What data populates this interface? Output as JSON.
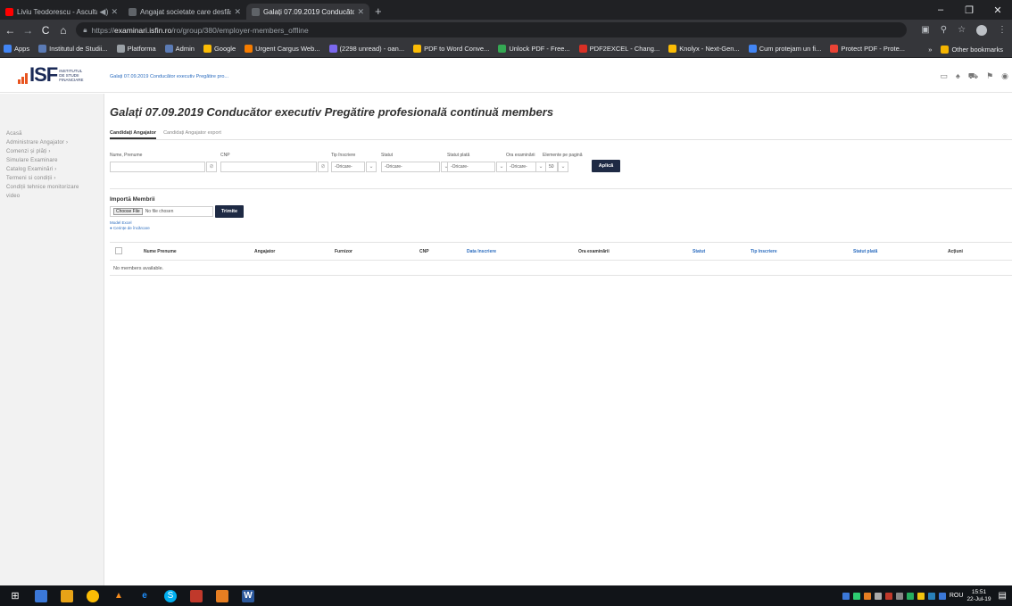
{
  "browser": {
    "tabs": [
      {
        "title": "Liviu Teodorescu - Asculta |",
        "color": "#ff0000",
        "active": false
      },
      {
        "title": "Angajat societate care desfășoar",
        "color": "#5f6368",
        "active": false
      },
      {
        "title": "Galați 07.09.2019 Conducător ex",
        "color": "#5f6368",
        "active": true
      }
    ],
    "new_tab": "+",
    "url_scheme": "https://",
    "url_host": "examinari.isfin.ro",
    "url_path": "/ro/group/380/employer-members_offline",
    "bookmarks": [
      {
        "label": "Apps",
        "color": "#4285f4"
      },
      {
        "label": "Institutul de Studii...",
        "color": "#5b7bb5"
      },
      {
        "label": "Platforma",
        "color": "#9aa0a6"
      },
      {
        "label": "Admin",
        "color": "#5b7bb5"
      },
      {
        "label": "Google",
        "color": "#fbbc05"
      },
      {
        "label": "Urgent Cargus Web...",
        "color": "#f57c00"
      },
      {
        "label": "(2298 unread) - oan...",
        "color": "#7b68ee"
      },
      {
        "label": "PDF to Word Conve...",
        "color": "#fbbc05"
      },
      {
        "label": "Unlock PDF - Free...",
        "color": "#34a853"
      },
      {
        "label": "PDF2EXCEL - Chang...",
        "color": "#d93025"
      },
      {
        "label": "Knolyx - Next-Gen...",
        "color": "#fbbc05"
      },
      {
        "label": "Cum protejam un fi...",
        "color": "#4285f4"
      },
      {
        "label": "Protect PDF - Prote...",
        "color": "#ea4335"
      }
    ],
    "other_bookmarks": "Other bookmarks",
    "overflow": "»"
  },
  "header": {
    "logo_text": "ISF",
    "logo_subtitle_1": "Institutul",
    "logo_subtitle_2": "de studii",
    "logo_subtitle_3": "financiare",
    "breadcrumb": "Galați 07.09.2019 Conducător executiv Pregătire pro..."
  },
  "sidebar": {
    "items": [
      "Acasă",
      "Administrare Angajator ›",
      "Comenzi și plăți ›",
      "Simulare Examinare",
      "Catalog Examinări ›",
      "Termeni si condiții ›",
      "Condiții tehnice monitorizare",
      "video"
    ]
  },
  "main": {
    "title": "Galați 07.09.2019 Conducător executiv Pregătire profesională continuă members",
    "tabs": [
      "Candidați Angajator",
      "Candidați Angajator export"
    ],
    "filters": {
      "name_label": "Nume, Prenume",
      "cnp_label": "CNP",
      "tip_label": "Tip înscriere",
      "statut_label": "Statut",
      "statut_plata_label": "Statut plată",
      "ora_label": "Ora examinării",
      "elemente_label": "Elemente pe pagină",
      "tip_value": "-Oricare-",
      "statut_value": "-Oricare-",
      "statut_plata_value": "-Oricare-",
      "ora_value": "-Oricare-",
      "elemente_value": "50",
      "apply": "Aplică"
    },
    "import": {
      "title": "Importă Membrii",
      "choose_button": "Choose File",
      "no_file": "No file chosen",
      "submit": "Trimite",
      "model_link": "Model Excel",
      "cerinte_link": "Cerințe de încărcare"
    },
    "table": {
      "headers": {
        "nume": "Nume Prenume",
        "angajator": "Angajator",
        "furnizor": "Furnizor",
        "cnp": "CNP",
        "data": "Data înscriere",
        "ora": "Ora examinării",
        "statut": "Statut",
        "tip": "Tip înscriere",
        "statut_plata": "Statut plată",
        "actiuni": "Acțiuni"
      },
      "empty_message": "No members available."
    }
  },
  "taskbar": {
    "language": "ROU",
    "time": "15:51",
    "date": "22-Jul-19"
  }
}
